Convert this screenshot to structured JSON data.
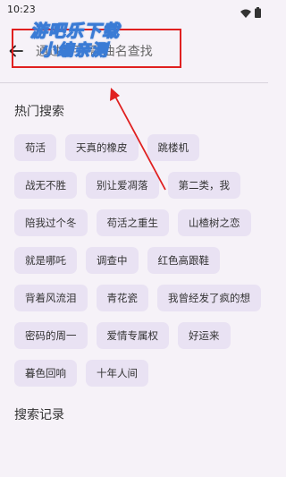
{
  "status_bar": {
    "time": "10:23",
    "icons": [
      "wifi-icon",
      "battery-icon"
    ]
  },
  "header": {
    "back_icon": "arrow-left-icon",
    "search_placeholder": "通过歌手/歌曲名查找"
  },
  "watermark": {
    "line1": "游吧乐下载",
    "line2": "小编亲测"
  },
  "hot_search": {
    "title": "热门搜索",
    "rows": [
      [
        "苟活",
        "天真的橡皮",
        "跳楼机"
      ],
      [
        "战无不胜",
        "别让爱凋落",
        "第二类，我"
      ],
      [
        "陪我过个冬",
        "苟活之重生",
        "山楂树之恋"
      ],
      [
        "就是哪吒",
        "调查中",
        "红色高跟鞋"
      ],
      [
        "背着风流泪",
        "青花瓷",
        "我曾经发了疯的想"
      ],
      [
        "密码的周一",
        "爱情专属权",
        "好运来"
      ],
      [
        "暮色回响",
        "十年人间"
      ]
    ]
  },
  "search_history": {
    "title": "搜索记录"
  },
  "colors": {
    "background": "#f6f2f8",
    "chip": "#e9e2f3",
    "annotation": "#e02020",
    "watermark_outline": "#3a7bd5"
  }
}
